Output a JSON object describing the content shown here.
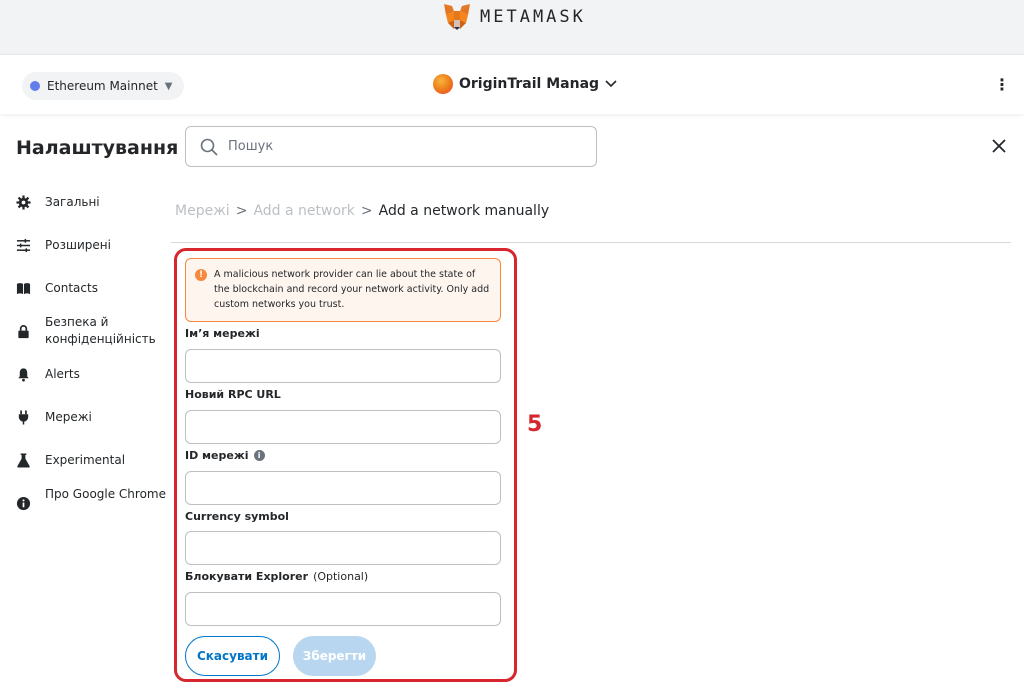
{
  "header": {
    "brand": "METAMASK",
    "network": "Ethereum Mainnet",
    "account": "OriginTrail Manag"
  },
  "settings": {
    "title": "Налаштування",
    "search_placeholder": "Пошук"
  },
  "sidebar": {
    "items": [
      {
        "label": "Загальні",
        "icon": "gear-icon"
      },
      {
        "label": "Розширені",
        "icon": "sliders-icon"
      },
      {
        "label": "Contacts",
        "icon": "book-icon"
      },
      {
        "label": "Безпека й конфіденційність",
        "icon": "lock-icon"
      },
      {
        "label": "Alerts",
        "icon": "bell-icon"
      },
      {
        "label": "Мережі",
        "icon": "plug-icon"
      },
      {
        "label": "Experimental",
        "icon": "flask-icon"
      },
      {
        "label": "Про Google Chrome",
        "icon": "info-icon"
      }
    ]
  },
  "breadcrumb": {
    "items": [
      "Мережі",
      "Add a network",
      "Add a network manually"
    ],
    "separator": ">"
  },
  "form": {
    "warning": "A malicious network provider can lie about the state of the blockchain and record your network activity. Only add custom networks you trust.",
    "fields": [
      {
        "label": "Ім’я мережі",
        "value": ""
      },
      {
        "label": "Новий RPC URL",
        "value": ""
      },
      {
        "label": "ID мережі",
        "value": ""
      },
      {
        "label": "Currency symbol",
        "value": ""
      },
      {
        "label": "Блокувати Explorer",
        "optional": "(Optional)",
        "value": ""
      }
    ],
    "cancel_label": "Скасувати",
    "save_label": "Зберегти"
  },
  "annotation": {
    "step_number": "5",
    "color": "#d7262d"
  },
  "colors": {
    "accent": "#0376c9",
    "warning_border": "#f8883b",
    "warning_bg": "#fef5ef"
  }
}
